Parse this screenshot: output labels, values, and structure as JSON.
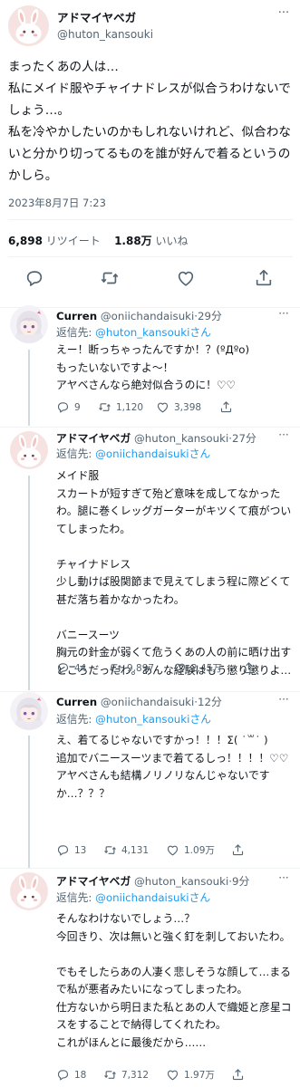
{
  "main": {
    "name": "アドマイヤベガ",
    "handle": "@huton_kansouki",
    "more": "···",
    "text": "まったくあの人は…\n私にメイド服やチャイナドレスが似合うわけないでしょう…。\n私を冷やかしたいのかもしれないけれど、似合わないと分かり切ってるものを誰が好んで着るというのかしら。",
    "timestamp": "2023年8月7日 7:23",
    "retweets": "6,898",
    "retweets_label": "リツイート",
    "likes": "1.88万",
    "likes_label": "いいね"
  },
  "replies": [
    {
      "name": "Curren",
      "handle": "@oniichandaisuki",
      "time": "29分",
      "to_label": "返信先: ",
      "to": "@huton_kansoukiさん",
      "text": "えー！断っちゃったんですか！？(ºДºo)\nもったいないですよ〜！\nアヤベさんなら絶対似合うのに！♡♡",
      "replies": "9",
      "retweets": "1,120",
      "likes": "3,398"
    },
    {
      "name": "アドマイヤベガ",
      "handle": "@huton_kansouki",
      "time": "27分",
      "to_label": "返信先: ",
      "to": "@oniichandaisukiさん",
      "text": "メイド服\nスカートが短すぎて殆ど意味を成してなかったわ。腿に巻くレッグガーターがキツくて痕がついてしまったわ。\n\nチャイナドレス\n少し動けば股関節まで見えてしまう程に際どくて甚だ落ち着かなかったわ。\n\nバニースーツ\n胸元の針金が弱くて危うくあの人の前に晒け出すところだったわ。あんな経験はもう懲り懲りよ…",
      "replies": "44",
      "retweets": "9,897",
      "likes": "2.45万"
    },
    {
      "name": "Curren",
      "handle": "@oniichandaisuki",
      "time": "12分",
      "to_label": "返信先: ",
      "to": "@huton_kansoukiさん",
      "text": "え、着てるじゃないですかっ！！！Σ( ˙꒳˙ )\n追加でバニースーツまで着てるしっ！！！！♡♡\nアヤベさんも結構ノリノリなんじゃないですか…？？？",
      "replies": "13",
      "retweets": "4,131",
      "likes": "1.09万"
    },
    {
      "name": "アドマイヤベガ",
      "handle": "@huton_kansouki",
      "time": "9分",
      "to_label": "返信先: ",
      "to": "@oniichandaisukiさん",
      "text": "そんなわけないでしょう…？\n今回きり、次は無いと強く釘を刺しておいたわ。\n\nでもそしたらあの人凄く悲しそうな顔して…まるで私が悪者みたいになってしまったわ。\n仕方ないから明日また私とあの人で織姫と彦星コスをすることで納得してくれたわ。\nこれがほんとに最後だから……",
      "replies": "18",
      "retweets": "7,312",
      "likes": "1.97万"
    }
  ]
}
